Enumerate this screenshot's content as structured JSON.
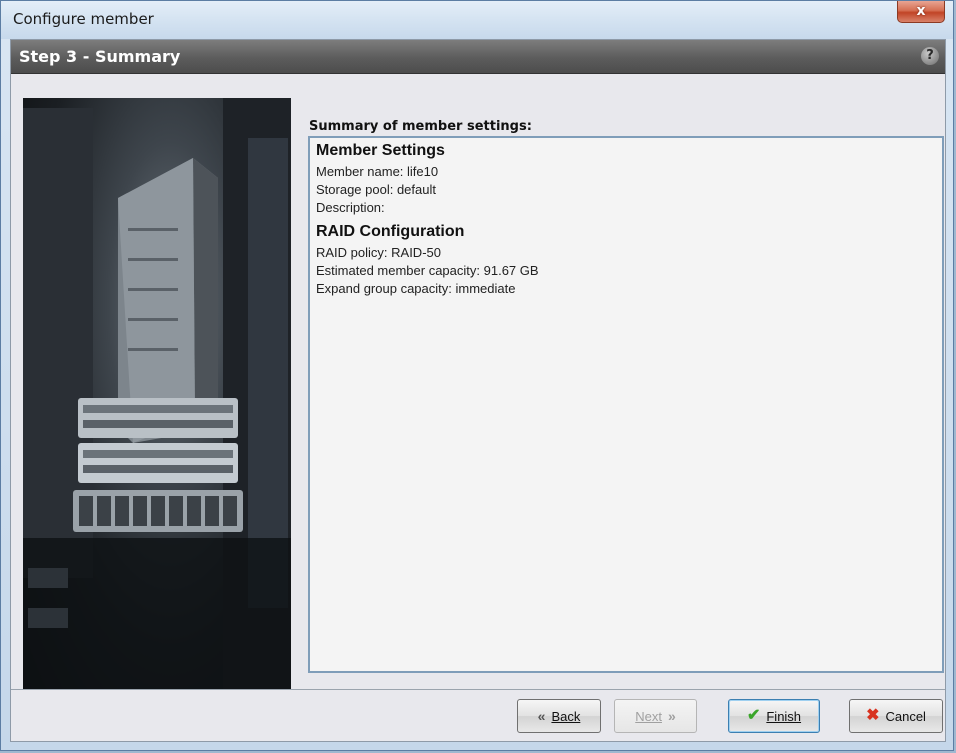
{
  "window": {
    "title": "Configure member",
    "close_glyph": "x"
  },
  "step": {
    "title": "Step 3 - Summary",
    "help_glyph": "?"
  },
  "summary": {
    "label": "Summary of member settings:",
    "member_heading": "Member Settings",
    "member_lines": [
      "Member name:  life10",
      "Storage pool:  default",
      "Description:"
    ],
    "raid_heading": "RAID Configuration",
    "raid_lines": [
      "RAID policy:  RAID-50",
      "Estimated member capacity:  91.67 GB",
      "Expand group capacity:  immediate"
    ]
  },
  "buttons": {
    "back": "Back",
    "next": "Next",
    "finish": "Finish",
    "cancel": "Cancel"
  },
  "icons": {
    "back": "double-chevron-left-icon",
    "next": "double-chevron-right-icon",
    "finish": "checkmark-icon",
    "cancel": "red-x-icon",
    "help": "help-icon",
    "close": "close-icon"
  },
  "colors": {
    "finish_check": "#3aa52a",
    "cancel_x": "#d8321f",
    "summary_border": "#7f9db9",
    "header_bg": "#5c5c5c"
  }
}
